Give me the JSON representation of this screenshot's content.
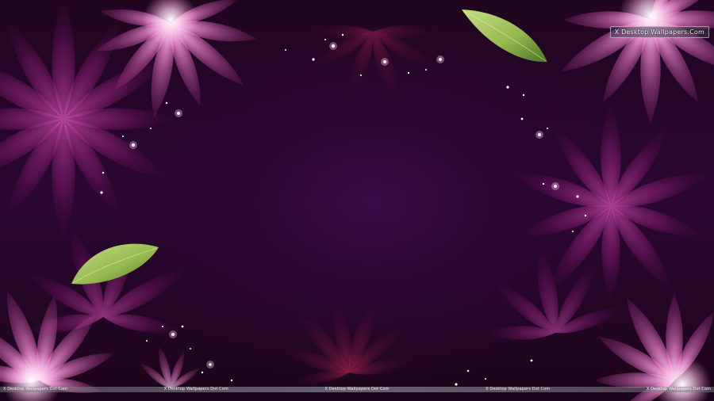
{
  "image": {
    "subject": "purple floral abstract wallpaper",
    "palette": {
      "background": "#2a0730",
      "petal_pink": "#e070c0",
      "petal_highlight": "#ffd8f0",
      "petal_magenta": "#a0207a",
      "leaf_green": "#a6cf5e"
    }
  },
  "watermark": {
    "badge": "X Desktop Wallpapers.Com",
    "strip": [
      "X Desktop Wallpapers Dot Com",
      "X Desktop Wallpapers Dot Com",
      "X Desktop Wallpapers Dot Com",
      "X Desktop Wallpapers Dot Com",
      "X Desktop Wallpapers Dot Com"
    ]
  }
}
